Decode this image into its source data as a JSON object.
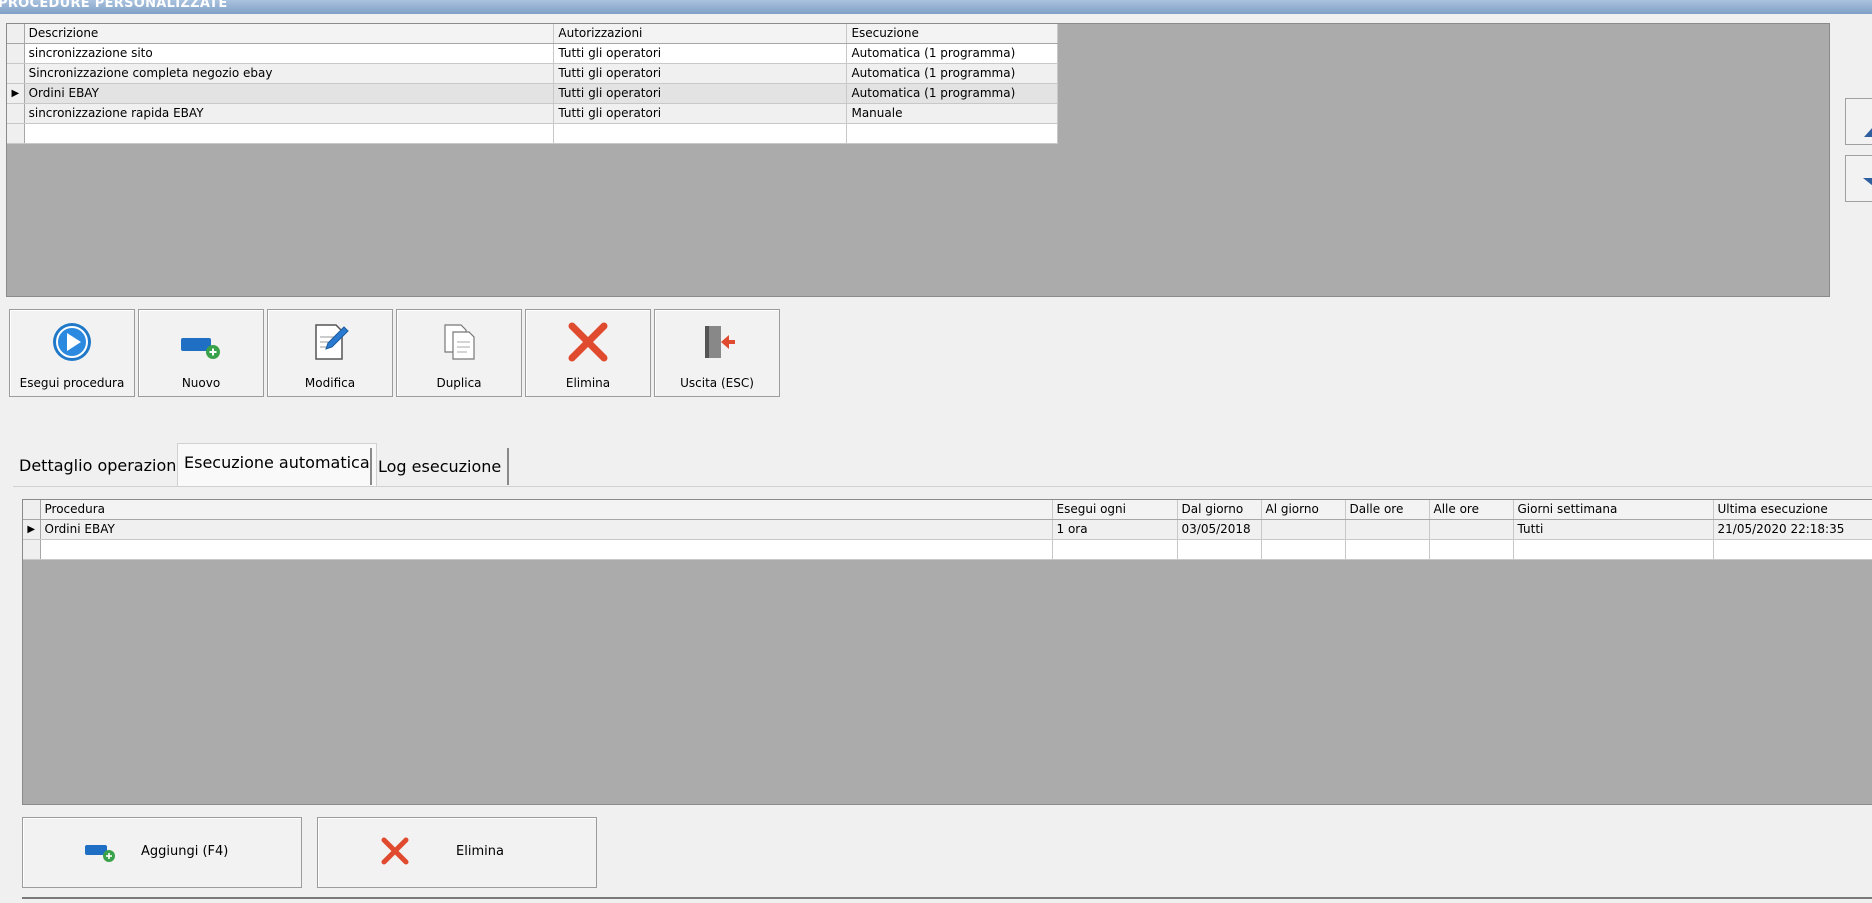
{
  "window": {
    "title": "PROCEDURE PERSONALIZZATE"
  },
  "procedures_grid": {
    "columns": [
      "Descrizione",
      "Autorizzazioni",
      "Esecuzione"
    ],
    "rows": [
      {
        "descrizione": "sincronizzazione sito",
        "autorizzazioni": "Tutti gli operatori",
        "esecuzione": "Automatica (1 programma)"
      },
      {
        "descrizione": "Sincronizzazione completa  negozio ebay",
        "autorizzazioni": "Tutti gli operatori",
        "esecuzione": "Automatica (1 programma)"
      },
      {
        "descrizione": "Ordini EBAY",
        "autorizzazioni": "Tutti gli operatori",
        "esecuzione": "Automatica (1 programma)"
      },
      {
        "descrizione": "sincronizzazione rapida EBAY",
        "autorizzazioni": "Tutti gli operatori",
        "esecuzione": "Manuale"
      }
    ],
    "selected_row_marker": "▶"
  },
  "toolbar": {
    "run_label": "Esegui procedura",
    "new_label": "Nuovo",
    "edit_label": "Modifica",
    "duplicate_label": "Duplica",
    "delete_label": "Elimina",
    "exit_label": "Uscita (ESC)"
  },
  "tabs": [
    {
      "label": "Dettaglio operazioni"
    },
    {
      "label": "Esecuzione automatica"
    },
    {
      "label": "Log esecuzione"
    }
  ],
  "schedule_grid": {
    "columns": [
      "Procedura",
      "Esegui ogni",
      "Dal giorno",
      "Al giorno",
      "Dalle ore",
      "Alle ore",
      "Giorni settimana",
      "Ultima esecuzione"
    ],
    "rows": [
      {
        "procedura": "Ordini EBAY",
        "esegui_ogni": "1 ora",
        "dal_giorno": "03/05/2018",
        "al_giorno": "",
        "dalle_ore": "",
        "alle_ore": "",
        "giorni_settimana": "Tutti",
        "ultima_esecuzione": "21/05/2020 22:18:35"
      }
    ],
    "selected_row_marker": "▶"
  },
  "bottom_buttons": {
    "add_label": "Aggiungi (F4)",
    "delete_label": "Elimina"
  },
  "colors": {
    "grid_background": "#ababab",
    "delete_red": "#e04a2f",
    "play_blue": "#1f78c8"
  }
}
